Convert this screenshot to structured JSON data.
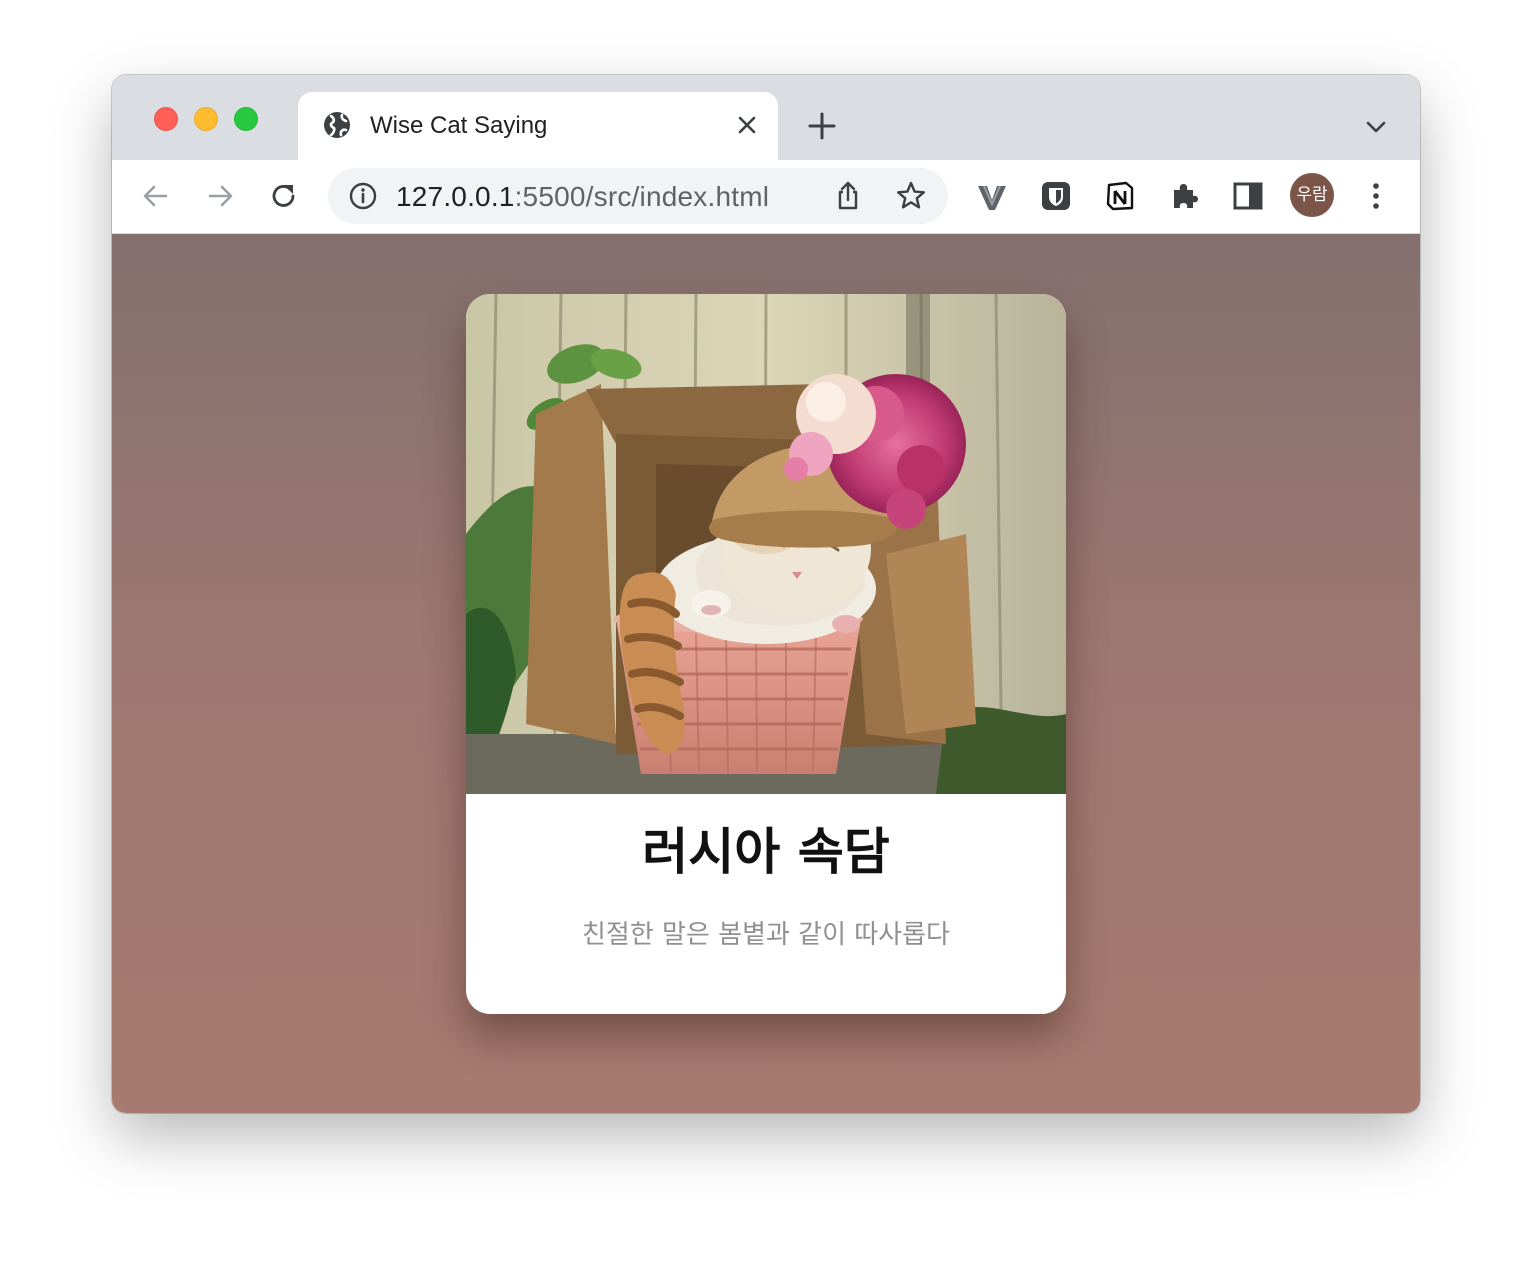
{
  "browser": {
    "tab": {
      "title": "Wise Cat Saying",
      "favicon": "globe-icon"
    },
    "new_tab_icon": "plus-icon",
    "tab_search_icon": "chevron-down-icon",
    "nav": {
      "back": "arrow-left-icon",
      "forward": "arrow-right-icon",
      "reload": "reload-icon"
    },
    "address": {
      "host": "127.0.0.1",
      "path": ":5500/src/index.html"
    },
    "extensions": [
      "vivaldi-v-icon",
      "shield-icon",
      "notion-icon",
      "puzzle-icon",
      "side-panel-icon"
    ],
    "profile": {
      "initials": "우람",
      "color": "#7a5548"
    },
    "menu_icon": "three-dots-icon"
  },
  "page": {
    "background": [
      "#84706f",
      "#a67a6f"
    ],
    "card": {
      "image": "cat-in-basket-with-flower-hat-photo",
      "title": "러시아 속담",
      "quote": "친절한 말은 봄볕과 같이 따사롭다"
    }
  }
}
